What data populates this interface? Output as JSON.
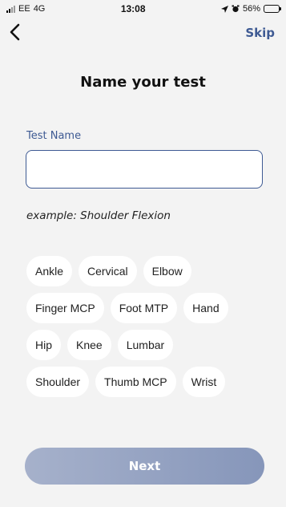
{
  "status_bar": {
    "carrier": "EE",
    "network": "4G",
    "time": "13:08",
    "battery": "56%"
  },
  "nav": {
    "back_icon": "chevron-left-icon",
    "skip_label": "Skip"
  },
  "title": "Name your test",
  "form": {
    "label": "Test Name",
    "value": "",
    "placeholder": ""
  },
  "example": "example: Shoulder Flexion",
  "chips": [
    [
      "Ankle",
      "Cervical",
      "Elbow"
    ],
    [
      "Finger MCP",
      "Foot MTP",
      "Hand"
    ],
    [
      "Hip",
      "Knee",
      "Lumbar"
    ],
    [
      "Shoulder",
      "Thumb MCP",
      "Wrist"
    ]
  ],
  "next_label": "Next",
  "colors": {
    "accent": "#3e5a93",
    "background": "#f3f3f3",
    "button_start": "#a6b1cb",
    "button_end": "#8696ba"
  }
}
